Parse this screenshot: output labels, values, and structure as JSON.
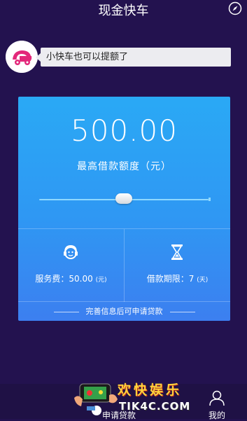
{
  "header": {
    "title": "现金快车",
    "compass_icon": "compass-icon"
  },
  "message": {
    "text": "小快车也可以提额了",
    "avatar_icon": "car-logo-icon"
  },
  "loan_card": {
    "amount": "500.00",
    "amount_label": "最高借款额度（元）",
    "slider_value_fraction": 0.5,
    "service_fee": {
      "label": "服务费：50.00",
      "unit": "(元)",
      "icon": "headset-icon"
    },
    "term": {
      "label": "借款期限：7",
      "unit": "(天)",
      "icon": "hourglass-icon"
    },
    "note": "完善信息后可申请贷款"
  },
  "tabbar": {
    "apply_label": "申请贷款",
    "mine_label": "我的",
    "mine_icon": "user-icon"
  },
  "promo": {
    "title": "欢快娱乐",
    "site": "TIK4C.COM"
  },
  "colors": {
    "background": "#23124f",
    "card_top": "#2aa9f5",
    "card_bottom": "#3c7ff0",
    "promo_yellow": "#ffd23c"
  }
}
